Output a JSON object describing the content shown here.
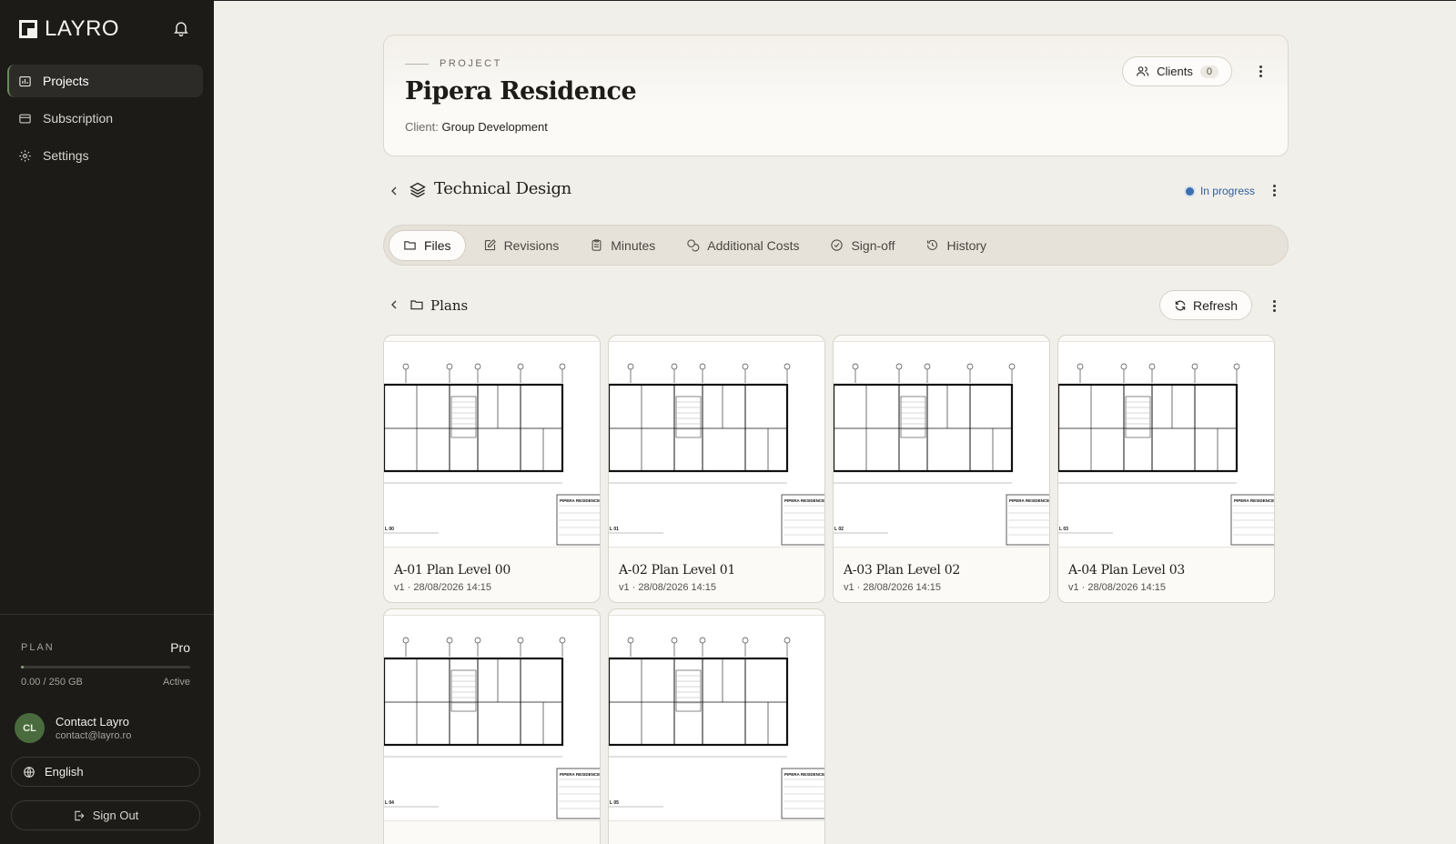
{
  "app": {
    "logo_text": "LAYRO"
  },
  "sidebar": {
    "items": [
      {
        "label": "Projects",
        "icon": "projects-icon",
        "active": true
      },
      {
        "label": "Subscription",
        "icon": "card-icon",
        "active": false
      },
      {
        "label": "Settings",
        "icon": "gear-icon",
        "active": false
      }
    ],
    "plan": {
      "label": "PLAN",
      "value": "Pro",
      "usage": "0.00 / 250 GB",
      "usage_fraction": 0.01,
      "status": "Active"
    },
    "user": {
      "initials": "CL",
      "name": "Contact Layro",
      "email": "contact@layro.ro"
    },
    "language": "English",
    "sign_out": "Sign Out"
  },
  "project": {
    "eyebrow": "PROJECT",
    "title": "Pipera Residence",
    "client_label": "Client:",
    "client_value": "Group Development",
    "clients_button": "Clients",
    "clients_count": "0"
  },
  "phase": {
    "title": "Technical Design",
    "status": "In progress",
    "status_color": "#3c6fb0"
  },
  "tabs": [
    {
      "label": "Files",
      "icon": "folder-icon",
      "active": true
    },
    {
      "label": "Revisions",
      "icon": "edit-icon",
      "active": false
    },
    {
      "label": "Minutes",
      "icon": "clipboard-icon",
      "active": false
    },
    {
      "label": "Additional Costs",
      "icon": "coins-icon",
      "active": false
    },
    {
      "label": "Sign-off",
      "icon": "check-circle-icon",
      "active": false
    },
    {
      "label": "History",
      "icon": "history-icon",
      "active": false
    }
  ],
  "folder": {
    "title": "Plans",
    "refresh_label": "Refresh"
  },
  "files": [
    {
      "title": "A-01 Plan Level 00",
      "meta": "v1 · 28/08/2026 14:15",
      "sheet_level": "L 00",
      "sheet_header": "PIPERA RESIDENCE"
    },
    {
      "title": "A-02 Plan Level 01",
      "meta": "v1 · 28/08/2026 14:15",
      "sheet_level": "L 01",
      "sheet_header": "PIPERA RESIDENCE"
    },
    {
      "title": "A-03 Plan Level 02",
      "meta": "v1 · 28/08/2026 14:15",
      "sheet_level": "L 02",
      "sheet_header": "PIPERA RESIDENCE"
    },
    {
      "title": "A-04 Plan Level 03",
      "meta": "v1 · 28/08/2026 14:15",
      "sheet_level": "L 03",
      "sheet_header": "PIPERA RESIDENCE"
    },
    {
      "title": "",
      "meta": "",
      "sheet_level": "L 04",
      "sheet_header": "PIPERA RESIDENCE"
    },
    {
      "title": "",
      "meta": "",
      "sheet_level": "L 05",
      "sheet_header": "PIPERA RESIDENCE"
    }
  ]
}
